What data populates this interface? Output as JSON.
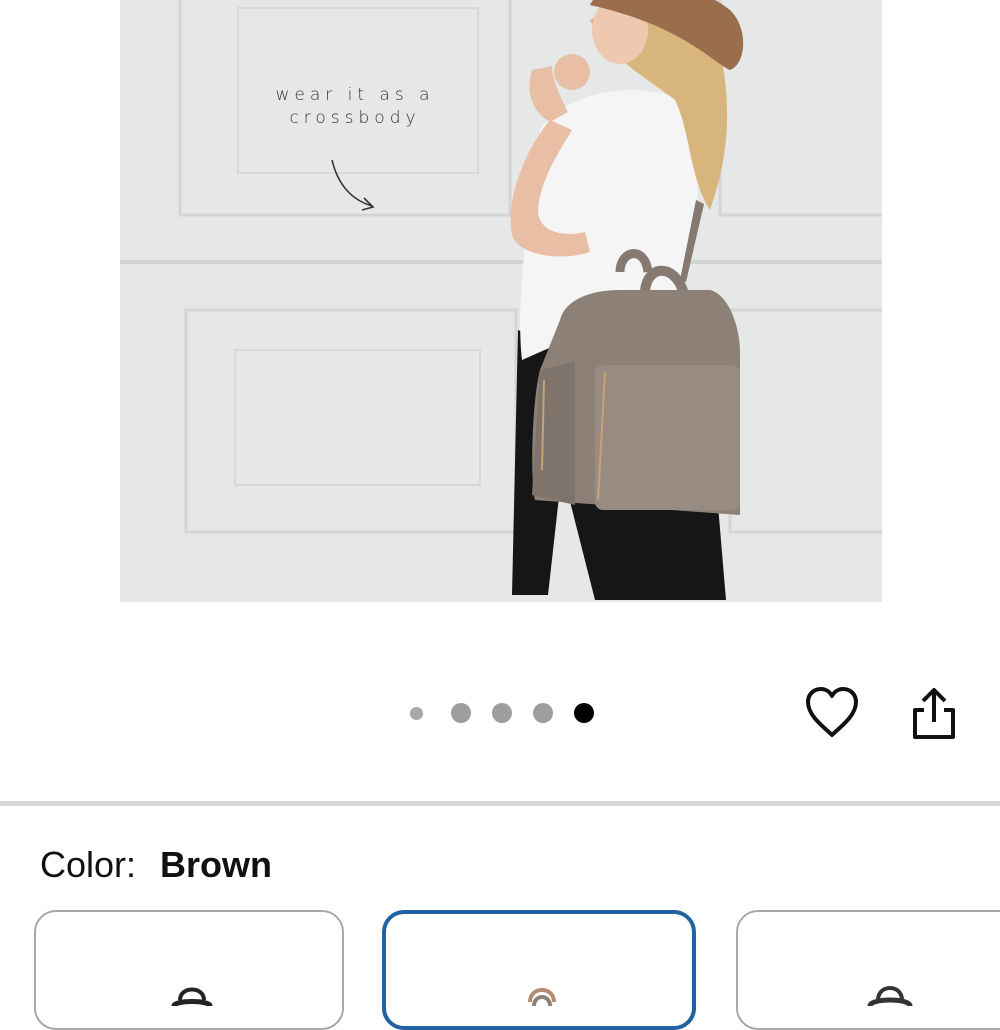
{
  "hero": {
    "caption_line1": "wear it as a",
    "caption_line2": "crossbody"
  },
  "carousel": {
    "dot_count": 5,
    "active_index": 4
  },
  "actions": {
    "favorite_icon": "heart-icon",
    "share_icon": "share-icon"
  },
  "color_selector": {
    "label": "Color:",
    "selected_value": "Brown",
    "options": [
      {
        "icon": "backpack-thumbnail-black"
      },
      {
        "icon": "backpack-thumbnail-brown",
        "selected": true
      },
      {
        "icon": "backpack-thumbnail-grey"
      }
    ]
  },
  "colors": {
    "selected_border": "#2162a1",
    "bag": "#8c8077",
    "active_dot": "#000000",
    "inactive_dot": "#9e9e9e"
  }
}
